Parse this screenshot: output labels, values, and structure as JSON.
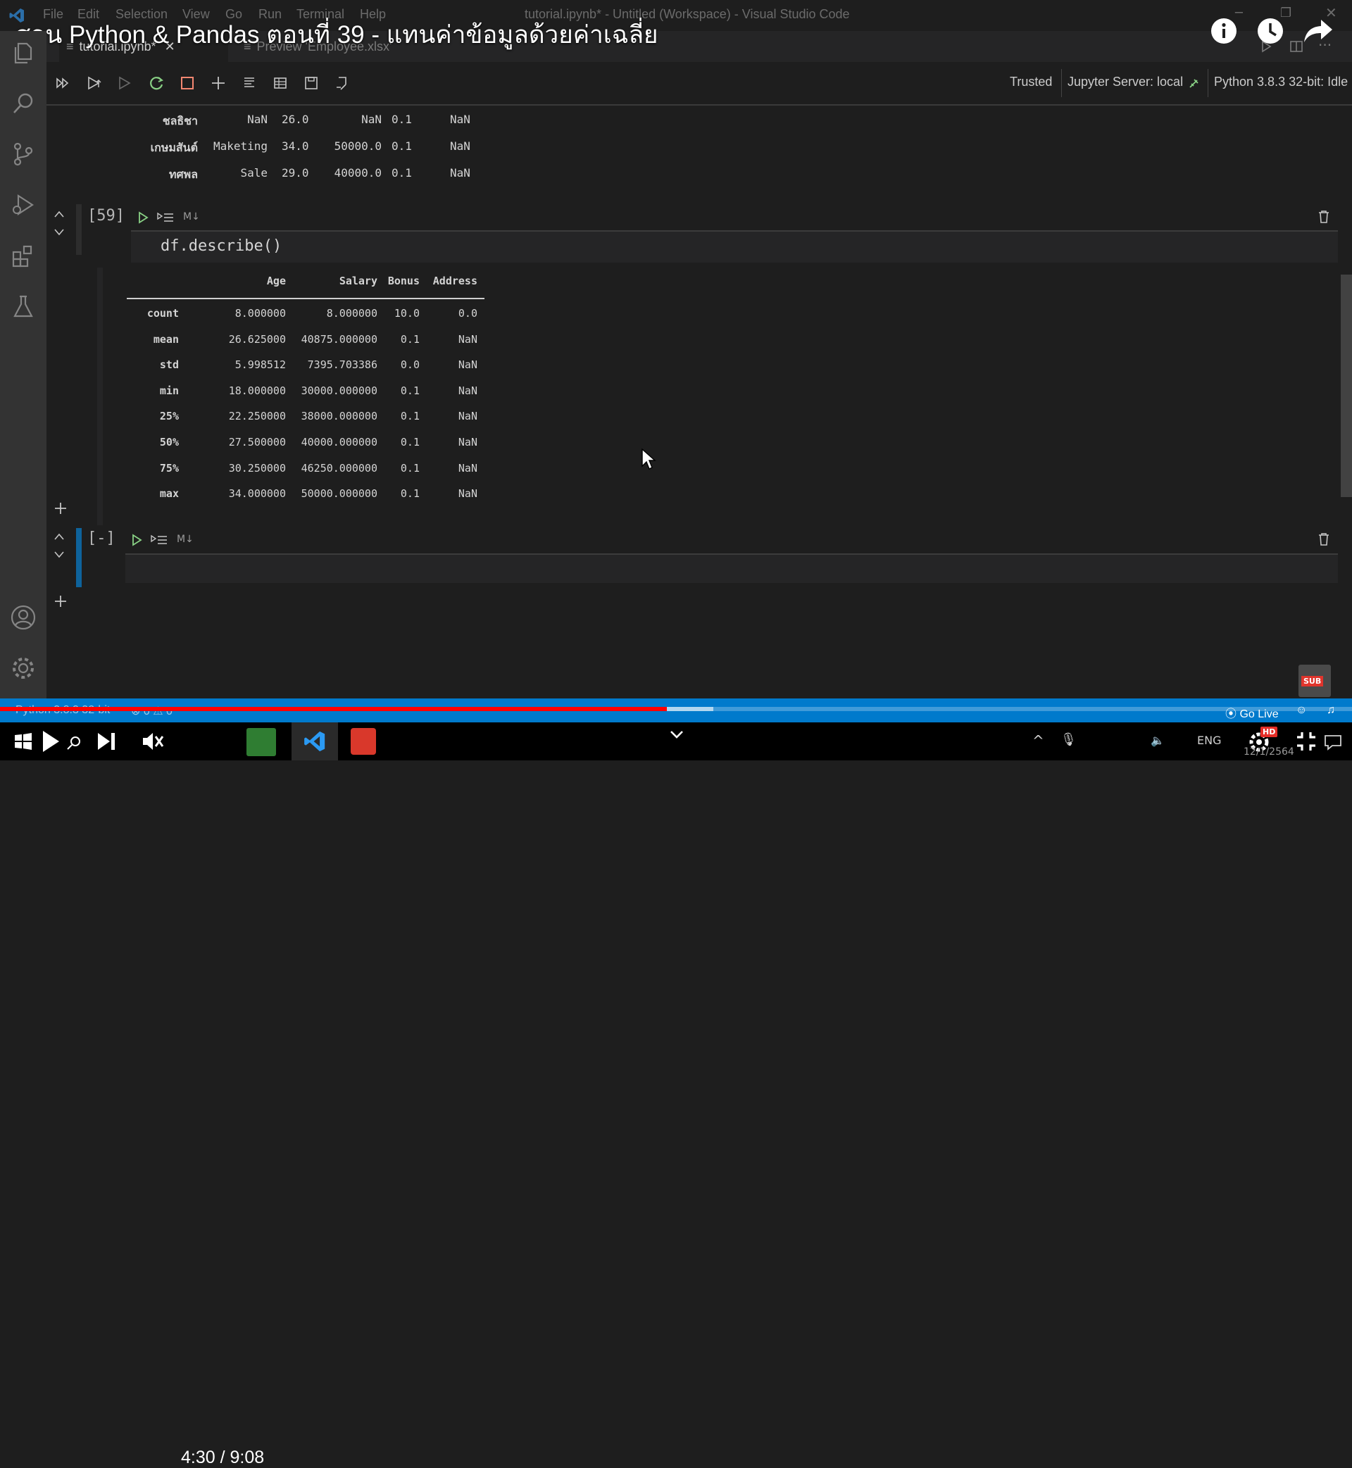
{
  "video": {
    "title": "สอน Python & Pandas ตอนที่ 39 - แทนค่าข้อมูลด้วยค่าเฉลี่ย",
    "time": "4:30 / 9:08",
    "progress_fraction": 0.493,
    "hd_badge": "HD",
    "sub_badge": "SUB"
  },
  "menu": [
    "File",
    "Edit",
    "Selection",
    "View",
    "Go",
    "Run",
    "Terminal",
    "Help"
  ],
  "window_title": "tutorial.ipynb* - Untitled (Workspace) - Visual Studio Code",
  "tabs": [
    {
      "label": "tutorial.ipynb*",
      "close": "✕"
    },
    {
      "label": "Preview 'Employee.xlsx'"
    }
  ],
  "toolbar": {
    "trusted": "Trusted",
    "jupyter_server": "Jupyter Server: local",
    "kernel": "Python 3.8.3 32-bit: Idle"
  },
  "prev_output": {
    "rows": [
      {
        "index": "ชลธิชา",
        "dept": "NaN",
        "age": "26.0",
        "salary": "NaN",
        "bonus": "0.1",
        "address": "NaN"
      },
      {
        "index": "เกษมสันต์",
        "dept": "Maketing",
        "age": "34.0",
        "salary": "50000.0",
        "bonus": "0.1",
        "address": "NaN"
      },
      {
        "index": "ทศพล",
        "dept": "Sale",
        "age": "29.0",
        "salary": "40000.0",
        "bonus": "0.1",
        "address": "NaN"
      }
    ]
  },
  "cell59": {
    "exec_count": "[59]",
    "md_label": "M↓",
    "code": "df.describe()"
  },
  "describe_table": {
    "columns": [
      "Age",
      "Salary",
      "Bonus",
      "Address"
    ],
    "rows": [
      {
        "stat": "count",
        "age": "8.000000",
        "salary": "8.000000",
        "bonus": "10.0",
        "address": "0.0"
      },
      {
        "stat": "mean",
        "age": "26.625000",
        "salary": "40875.000000",
        "bonus": "0.1",
        "address": "NaN"
      },
      {
        "stat": "std",
        "age": "5.998512",
        "salary": "7395.703386",
        "bonus": "0.0",
        "address": "NaN"
      },
      {
        "stat": "min",
        "age": "18.000000",
        "salary": "30000.000000",
        "bonus": "0.1",
        "address": "NaN"
      },
      {
        "stat": "25%",
        "age": "22.250000",
        "salary": "38000.000000",
        "bonus": "0.1",
        "address": "NaN"
      },
      {
        "stat": "50%",
        "age": "27.500000",
        "salary": "40000.000000",
        "bonus": "0.1",
        "address": "NaN"
      },
      {
        "stat": "75%",
        "age": "30.250000",
        "salary": "46250.000000",
        "bonus": "0.1",
        "address": "NaN"
      },
      {
        "stat": "max",
        "age": "34.000000",
        "salary": "50000.000000",
        "bonus": "0.1",
        "address": "NaN"
      }
    ]
  },
  "empty_cell": {
    "exec_count": "[-]",
    "md_label": "M↓"
  },
  "statusbar": {
    "python": "Python 3.8.3 32-bit",
    "problems": "⊗ 0 ⚠ 0",
    "go_live": "Go Live"
  },
  "taskbar": {
    "date": "12/1/2564",
    "lang": "ENG"
  },
  "colors": {
    "accent": "#007acc",
    "progress": "#ff0000",
    "run_green": "#89d185",
    "stop_red": "#f48771"
  },
  "icons": [
    "vscode-logo-icon",
    "explorer-icon",
    "search-icon",
    "source-control-icon",
    "run-debug-icon",
    "extensions-icon",
    "testing-icon",
    "account-icon",
    "settings-gear-icon",
    "info-icon",
    "watch-later-icon",
    "share-icon"
  ]
}
